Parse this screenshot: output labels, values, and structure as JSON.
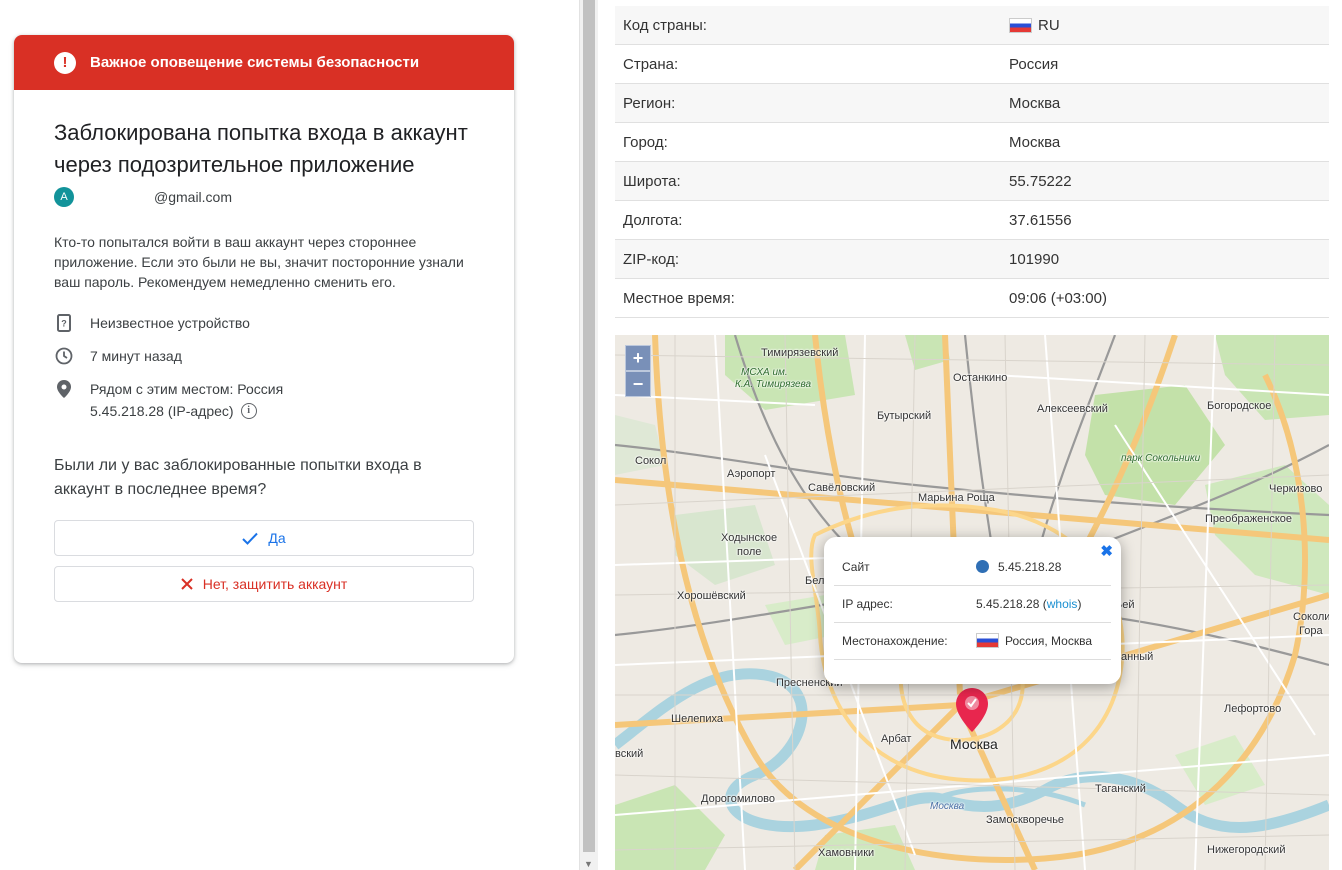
{
  "alert": {
    "header": "Важное оповещение системы безопасности",
    "title": "Заблокирована попытка входа в аккаунт через подозрительное приложение",
    "avatar_letter": "A",
    "email": "@gmail.com",
    "description": "Кто-то попытался войти в ваш аккаунт через стороннее приложение. Если это были не вы, значит посторонние узнали ваш пароль. Рекомендуем немедленно сменить его.",
    "device": "Неизвестное устройство",
    "time": "7 минут назад",
    "location": "Рядом с этим местом: Россия",
    "ip": "5.45.218.28 (IP-адрес)",
    "question": "Были ли у вас заблокированные попытки входа в аккаунт в последнее время?",
    "yes_label": "Да",
    "no_label": "Нет, защитить аккаунт",
    "accent_color": "#d93025"
  },
  "geo": {
    "rows": [
      {
        "label": "Код страны:",
        "value": "RU"
      },
      {
        "label": "Страна:",
        "value": "Россия"
      },
      {
        "label": "Регион:",
        "value": "Москва"
      },
      {
        "label": "Город:",
        "value": "Москва"
      },
      {
        "label": "Широта:",
        "value": "55.75222"
      },
      {
        "label": "Долгота:",
        "value": "37.61556"
      },
      {
        "label": "ZIP-код:",
        "value": "101990"
      },
      {
        "label": "Местное время:",
        "value": "09:06 (+03:00)"
      }
    ]
  },
  "map": {
    "zoom_in": "+",
    "zoom_out": "−",
    "labels": {
      "timiryazevsky": "Тимирязевский",
      "mskha1": "МСХА им.",
      "mskha2": "К.А. Тимирязева",
      "ostankino": "Останкино",
      "butyrsky": "Бутырский",
      "alekseevsky": "Алексеевский",
      "bogorodskoe": "Богородское",
      "park": "парк Сокольники",
      "sokol": "Сокол",
      "aeroport": "Аэропорт",
      "savelovsky": "Савёловский",
      "maryina": "Марьина Роща",
      "cherkizovo": "Черкизово",
      "preobrazhenskoe": "Преображенское",
      "khodynka1": "Ходынское",
      "khodynka2": "поле",
      "khoroshevsky": "Хорошёвский",
      "sokolinaya1": "Соколи",
      "sokolinaya2": "Гора",
      "presnensky": "Пресненский",
      "shelepikha": "Шелепиха",
      "arbat": "Арбат",
      "moscow": "Москва",
      "lefortovo": "Лефортово",
      "dorogomilovo": "Дорогомилово",
      "moscow_river": "Москва",
      "tagansky": "Таганский",
      "zamoskvorechye": "Замоскворечье",
      "khamovniki": "Хамовники",
      "nizhegorodsky": "Нижегородский",
      "vskiy": "вский",
      "mannyi": "анный",
      "bel": "Бел",
      "bei": "Бей"
    },
    "popup": {
      "site_label": "Сайт",
      "site_value": "5.45.218.28",
      "ip_label": "IP адрес:",
      "ip_value": "5.45.218.28",
      "whois": "whois",
      "location_label": "Местонахождение:",
      "location_value": "Россия, Москва",
      "close": "✖"
    }
  }
}
